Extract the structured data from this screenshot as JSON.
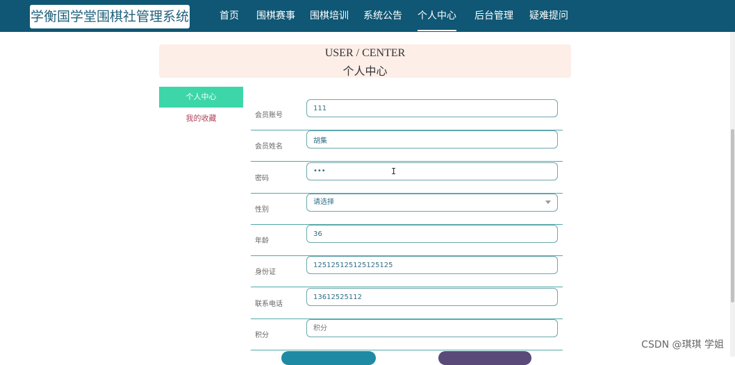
{
  "app": {
    "title": "学衡国学堂围棋社管理系统"
  },
  "nav": {
    "items": [
      {
        "label": "首页"
      },
      {
        "label": "围棋赛事"
      },
      {
        "label": "围棋培训"
      },
      {
        "label": "系统公告"
      },
      {
        "label": "个人中心",
        "active": true
      },
      {
        "label": "后台管理"
      },
      {
        "label": "疑难提问"
      }
    ]
  },
  "banner": {
    "title_en": "USER / CENTER",
    "title_cn": "个人中心"
  },
  "sidebar": {
    "items": [
      {
        "label": "个人中心",
        "active": true
      },
      {
        "label": "我的收藏"
      }
    ]
  },
  "form": {
    "fields": [
      {
        "label": "会员账号",
        "value": "111"
      },
      {
        "label": "会员姓名",
        "value": "胡集"
      },
      {
        "label": "密码",
        "value": "•••"
      },
      {
        "label": "性别",
        "value": "请选择",
        "type": "select"
      },
      {
        "label": "年龄",
        "value": "36"
      },
      {
        "label": "身份证",
        "value": "125125125125125125"
      },
      {
        "label": "联系电话",
        "value": "13612525112"
      },
      {
        "label": "积分",
        "value": "",
        "placeholder": "积分"
      }
    ]
  },
  "buttons": {
    "primary_color": "#1f8aa3",
    "secondary_color": "#5a4a7a"
  },
  "watermark": "CSDN @琪琪 学姐",
  "colors": {
    "navbar": "#0f5774",
    "banner_bg": "#fdeee8",
    "sidebar_active": "#3dd6a8",
    "sidebar_item_text": "#b0435c",
    "row_border": "#4fa7aa"
  }
}
